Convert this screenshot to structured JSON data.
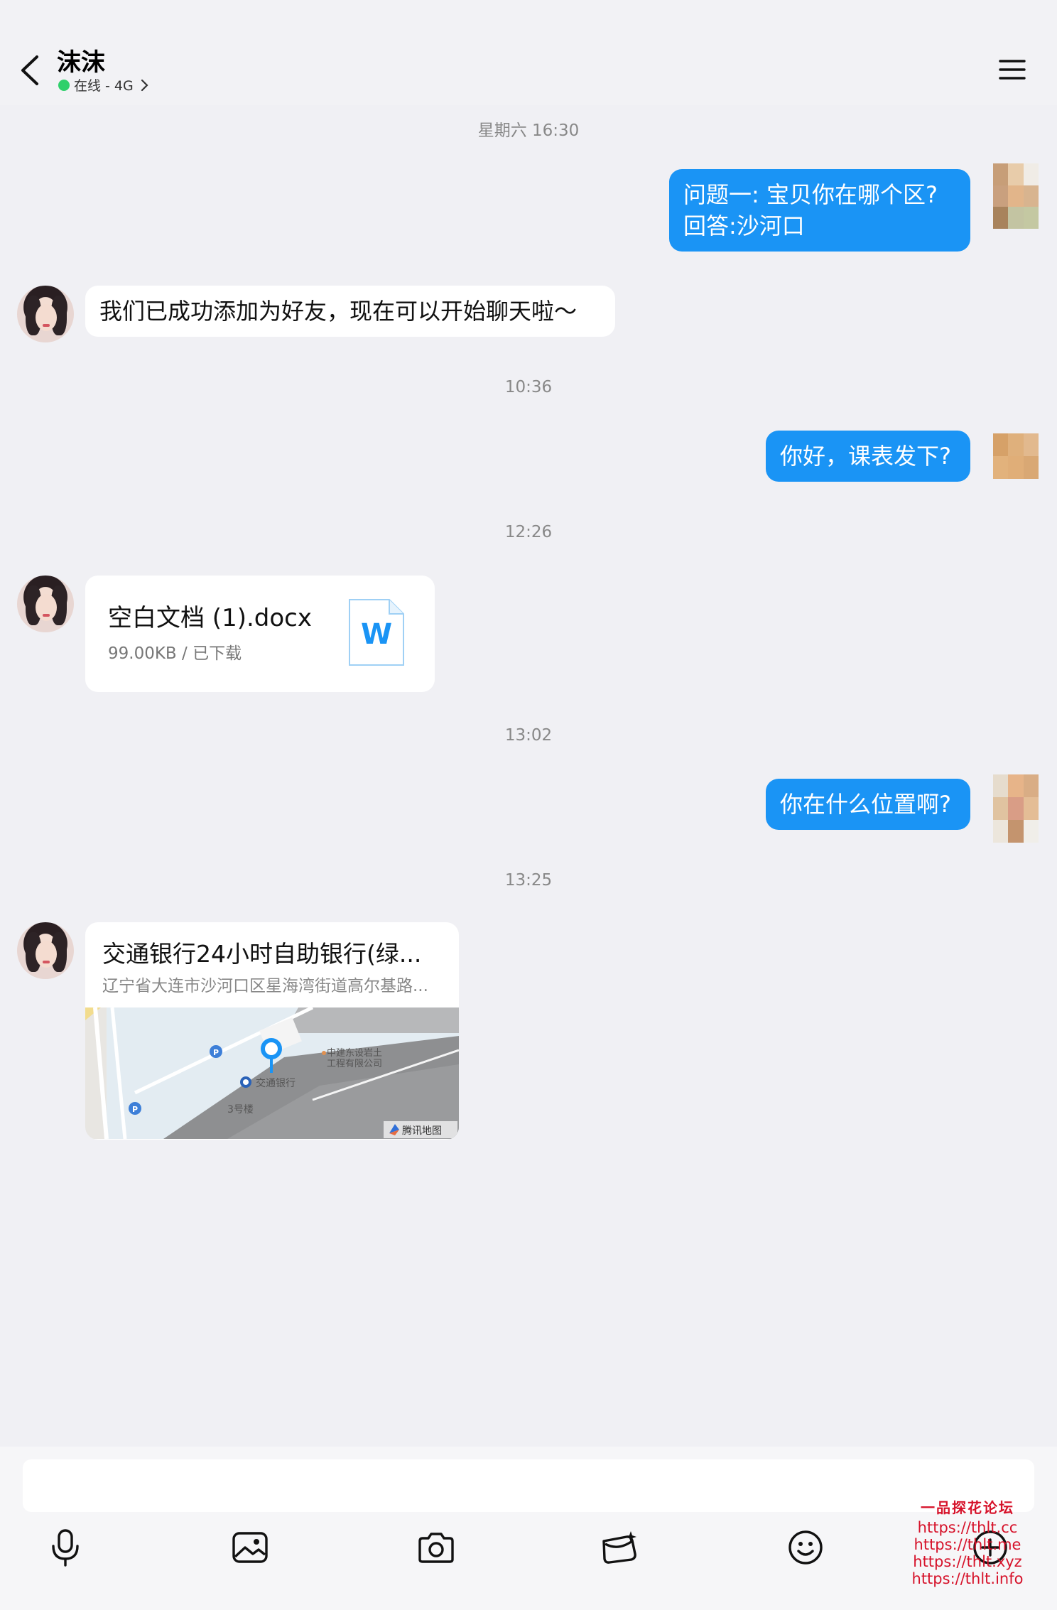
{
  "header": {
    "title": "沫沫",
    "status": "在线 - 4G"
  },
  "messages": {
    "ts1": "星期六 16:30",
    "out1_line1": "问题一: 宝贝你在哪个区?",
    "out1_line2": "回答:沙河口",
    "in1": "我们已成功添加为好友，现在可以开始聊天啦～",
    "ts2": "10:36",
    "out2": "你好，课表发下?",
    "ts3": "12:26",
    "file": {
      "name": "空白文档 (1).docx",
      "meta": "99.00KB / 已下载",
      "icon": "word-doc-icon"
    },
    "ts4": "13:02",
    "out3": "你在什么位置啊?",
    "ts5": "13:25",
    "location": {
      "title": "交通银行24小时自助银行(绿...",
      "address": "辽宁省大连市沙河口区星海湾街道高尔基路...",
      "map_labels": {
        "company": "中建东设岩土\n工程有限公司",
        "bank": "交通银行",
        "building": "3号楼",
        "provider": "腾讯地图"
      }
    }
  },
  "input": {
    "value": "",
    "placeholder": ""
  },
  "toolbar": [
    "mic-icon",
    "image-icon",
    "camera-icon",
    "red-packet-icon",
    "emoji-icon",
    "plus-icon"
  ],
  "watermark": {
    "title": "一品探花论坛",
    "urls": [
      "https://thlt.cc",
      "https://thlt.me",
      "https://thlt.xyz",
      "https://thlt.info"
    ]
  },
  "colors": {
    "accent": "#1a94f5",
    "online": "#2fd06b",
    "background": "#f0f0f4"
  }
}
